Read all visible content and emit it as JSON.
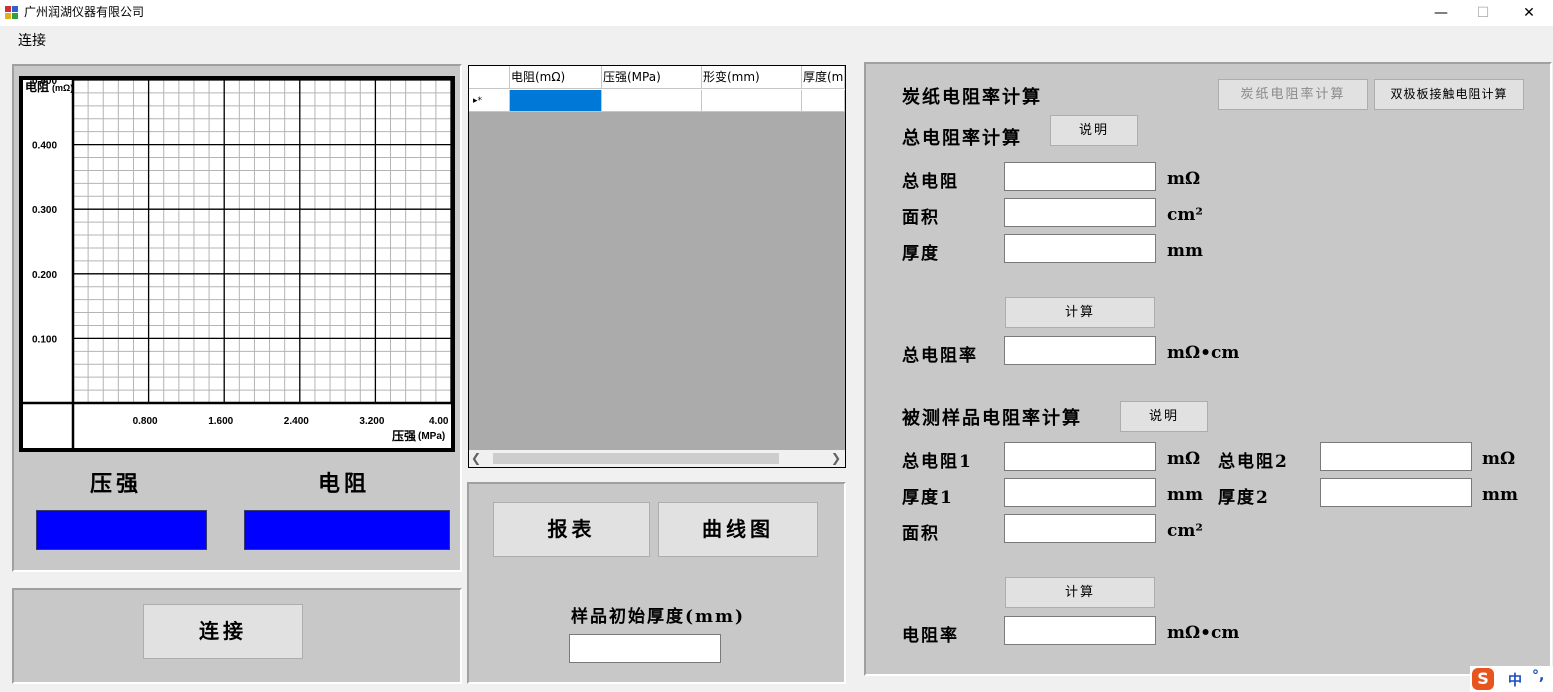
{
  "window": {
    "title": "广州润湖仪器有限公司",
    "minimize_glyph": "—",
    "maximize_glyph": "☐",
    "close_glyph": "✕"
  },
  "menu": {
    "connect": "连接"
  },
  "chart": {
    "chart_data": {
      "type": "line",
      "title": "",
      "xlabel": "压强",
      "xlabel_unit": "(MPa)",
      "ylabel": "电阻",
      "ylabel_unit": "(mΩ)",
      "xlim": [
        0,
        4.0
      ],
      "ylim": [
        0,
        0.5
      ],
      "x_ticks": [
        0.8,
        1.6,
        2.4,
        3.2,
        4.0
      ],
      "x_tick_labels": [
        "0.800",
        "1.600",
        "2.400",
        "3.200",
        "4.00"
      ],
      "y_ticks": [
        0.1,
        0.2,
        0.3,
        0.4,
        0.5
      ],
      "y_tick_labels": [
        "0.100",
        "0.200",
        "0.300",
        "0.400",
        "0.500"
      ],
      "grid": true,
      "series": []
    }
  },
  "readout": {
    "pressure_label": "压强",
    "resistance_label": "电阻",
    "pressure_color": "#0000ff",
    "resistance_color": "#0000ff"
  },
  "connect_button": "连接",
  "grid": {
    "columns": [
      "电阻(mΩ)",
      "压强(MPa)",
      "形变(mm)",
      "厚度(m"
    ],
    "new_row_marker": "▸*",
    "selection_color": "#0078d7"
  },
  "report": {
    "report_button": "报表",
    "curve_button": "曲线图",
    "initial_thickness_label": "样品初始厚度(mm)",
    "initial_thickness_value": ""
  },
  "calc": {
    "carbon_title": "炭纸电阻率计算",
    "tab_carbon": "炭纸电阻率计算",
    "tab_bipolar": "双极板接触电阻计算",
    "total_title": "总电阻率计算",
    "explain": "说明",
    "total_resistance": "总电阻",
    "area": "面积",
    "thickness": "厚度",
    "unit_mohm": "mΩ",
    "unit_cm2": "cm²",
    "unit_mm": "mm",
    "compute": "计算",
    "total_resistivity": "总电阻率",
    "unit_mohm_cm": "mΩ•cm",
    "sample_title": "被测样品电阻率计算",
    "total_resistance_1": "总电阻1",
    "total_resistance_2": "总电阻2",
    "thickness_1": "厚度1",
    "thickness_2": "厚度2",
    "resistivity": "电阻率",
    "values": {
      "total_resistance": "",
      "area": "",
      "thickness": "",
      "total_resistivity": "",
      "total_resistance_1": "",
      "total_resistance_2": "",
      "thickness_1": "",
      "thickness_2": "",
      "sample_area": "",
      "resistivity": ""
    }
  },
  "ime": {
    "logo": "S",
    "mode": "中",
    "punct": "°,"
  }
}
